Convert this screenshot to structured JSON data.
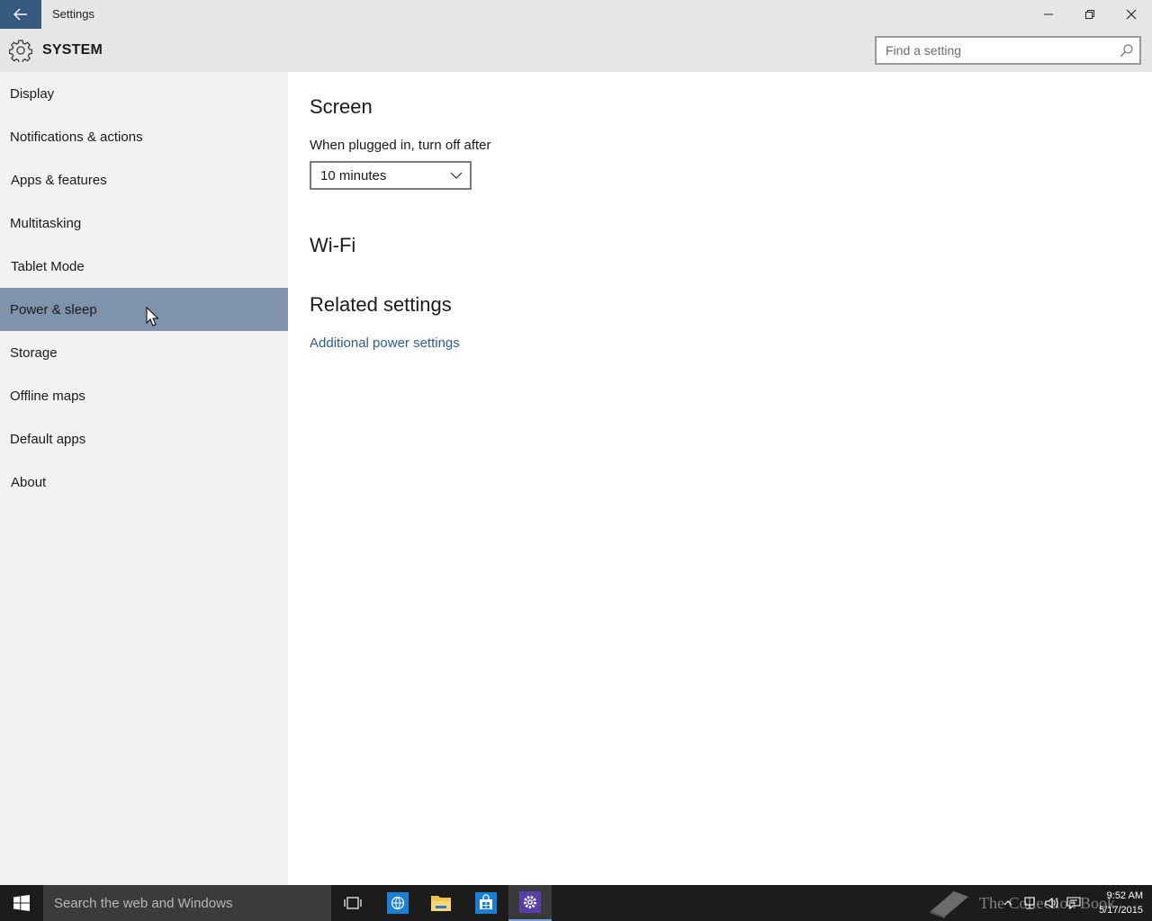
{
  "window": {
    "title": "Settings"
  },
  "header": {
    "section": "SYSTEM",
    "search_placeholder": "Find a setting"
  },
  "sidebar": {
    "items": [
      {
        "label": "Display"
      },
      {
        "label": "Notifications & actions"
      },
      {
        "label": "Apps & features"
      },
      {
        "label": "Multitasking"
      },
      {
        "label": "Tablet Mode"
      },
      {
        "label": "Power & sleep",
        "selected": true
      },
      {
        "label": "Storage"
      },
      {
        "label": "Offline maps"
      },
      {
        "label": "Default apps"
      },
      {
        "label": "About"
      }
    ]
  },
  "main": {
    "screen_heading": "Screen",
    "plugged_label": "When plugged in, turn off after",
    "plugged_value": "10 minutes",
    "wifi_heading": "Wi-Fi",
    "related_heading": "Related settings",
    "related_link": "Additional power settings"
  },
  "taskbar": {
    "search_text": "Search the web and Windows",
    "apps": [
      "task-view-icon",
      "internet-explorer-icon",
      "file-explorer-icon",
      "store-icon",
      "settings-icon"
    ],
    "time": "9:52 AM",
    "date": "5/17/2015",
    "watermark": "The Collection Book"
  },
  "colors": {
    "accent": "#375a7f",
    "selected": "#7f93ad",
    "link": "#2b5d8c"
  }
}
